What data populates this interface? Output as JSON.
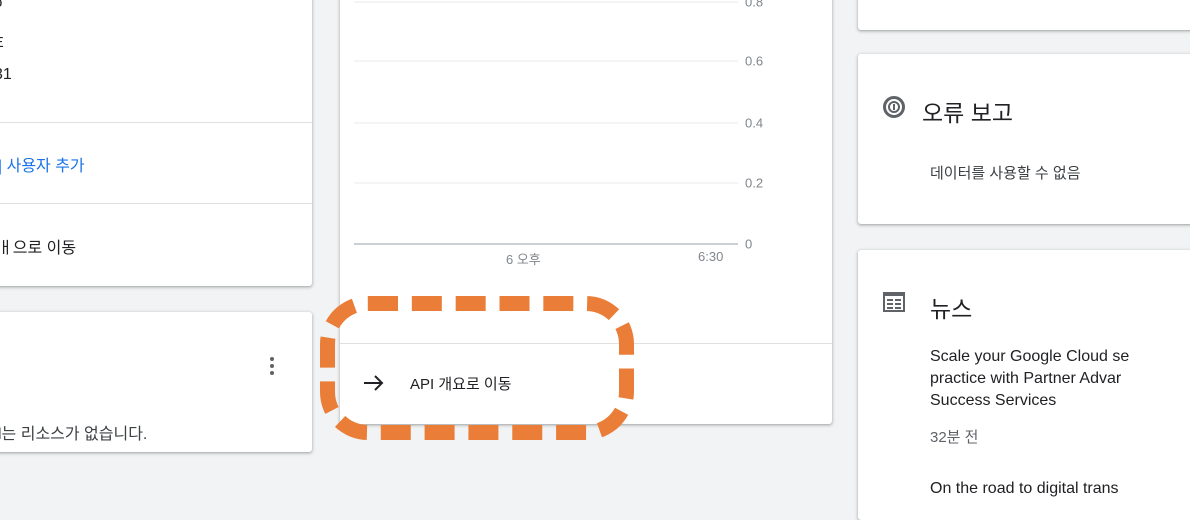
{
  "left_card": {
    "value_line_1": "o",
    "value_line_2": "Ξ",
    "value_line_3": "31",
    "add_user_link": "| 사용자 추가",
    "go_link": "ㅐ으로 이동"
  },
  "resources_card": {
    "empty_text": "l는 리소스가 없습니다."
  },
  "chart_card": {
    "go_api_label": "API 개요로 이동"
  },
  "chart_data": {
    "type": "line",
    "x_ticks": [
      "6 오후",
      "6:30"
    ],
    "y_ticks": [
      "0.8",
      "0.6",
      "0.4",
      "0.2",
      "0"
    ],
    "ylim": [
      0,
      1
    ],
    "series": [],
    "grid": true
  },
  "error_card": {
    "title": "오류 보고",
    "status": "데이터를 사용할 수 없음"
  },
  "news_card": {
    "title": "뉴스",
    "items": [
      {
        "lines": [
          "Scale your Google Cloud se",
          "practice with Partner Advar",
          "Success Services"
        ],
        "time": "32분 전"
      },
      {
        "lines": [
          "On the road to digital trans"
        ]
      }
    ]
  },
  "colors": {
    "link_blue": "#1a73e8",
    "callout_orange": "#ea7e38",
    "background": "#f1f3f4"
  }
}
